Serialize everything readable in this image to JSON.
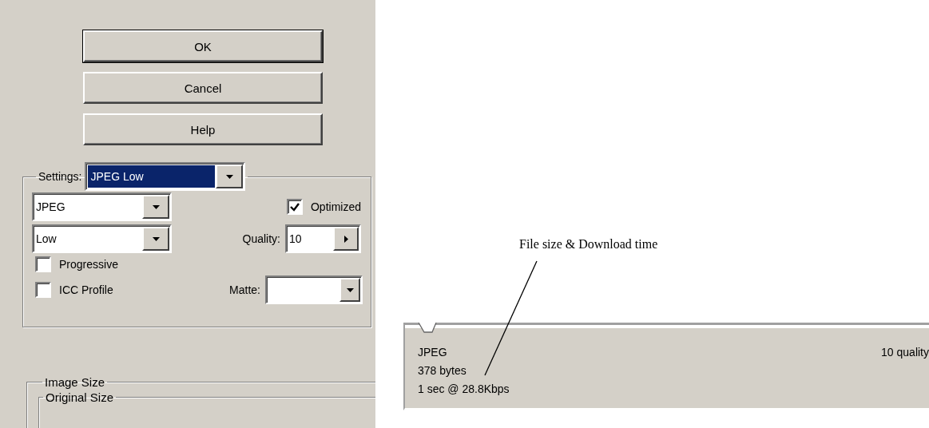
{
  "buttons": [
    {
      "label": "OK",
      "default": true
    },
    {
      "label": "Cancel",
      "default": false
    },
    {
      "label": "Help",
      "default": false
    }
  ],
  "settings": {
    "label": "Settings:",
    "preset": {
      "value": "JPEG Low",
      "focused": true
    },
    "format": "JPEG",
    "quality_preset": "Low",
    "optimized": {
      "label": "Optimized",
      "checked": true
    },
    "quality": {
      "label": "Quality:",
      "value": "10"
    },
    "progressive": {
      "label": "Progressive",
      "checked": false
    },
    "icc_profile": {
      "label": "ICC Profile",
      "checked": false
    },
    "matte": {
      "label": "Matte:"
    }
  },
  "image_size": {
    "title": "Image Size",
    "original_size": {
      "title": "Original Size"
    }
  },
  "annotation": "File size & Download time",
  "preview_info": {
    "format": "JPEG",
    "size": "378 bytes",
    "download_time": "1 sec @ 28.8Kbps",
    "quality": "10 quality"
  }
}
